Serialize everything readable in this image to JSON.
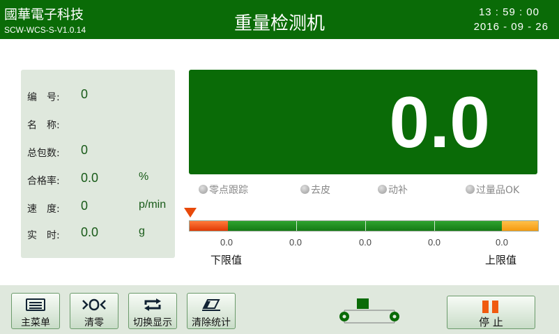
{
  "header": {
    "company": "國華電子科技",
    "version": "SCW-WCS-S-V1.0.14",
    "title": "重量检测机",
    "time": "13 : 59 : 00",
    "date": "2016 - 09 - 26"
  },
  "info": {
    "rows": [
      {
        "label": "编　号:",
        "value": "0",
        "unit": ""
      },
      {
        "label": "名　称:",
        "value": "",
        "unit": ""
      },
      {
        "label": "总包数:",
        "value": "0",
        "unit": ""
      },
      {
        "label": "合格率:",
        "value": "0.0",
        "unit": "%"
      },
      {
        "label": "速　度:",
        "value": "0",
        "unit": "p/min"
      },
      {
        "label": "实　时:",
        "value": "0.0",
        "unit": "g"
      }
    ]
  },
  "display": {
    "weight": "0.0"
  },
  "indicators": [
    "零点跟踪",
    "去皮",
    "动补",
    "过量品OK"
  ],
  "scale": {
    "values": [
      "0.0",
      "0.0",
      "0.0",
      "0.0",
      "0.0"
    ],
    "lower_label": "下限值",
    "upper_label": "上限值"
  },
  "footer": {
    "buttons": [
      "主菜单",
      "清零",
      "切换显示",
      "清除统计"
    ],
    "stop_label": "停 止"
  },
  "colors": {
    "primary": "#0a6b07",
    "panel": "#dfe8dd",
    "low": "#e8490a",
    "high": "#f59a10"
  }
}
